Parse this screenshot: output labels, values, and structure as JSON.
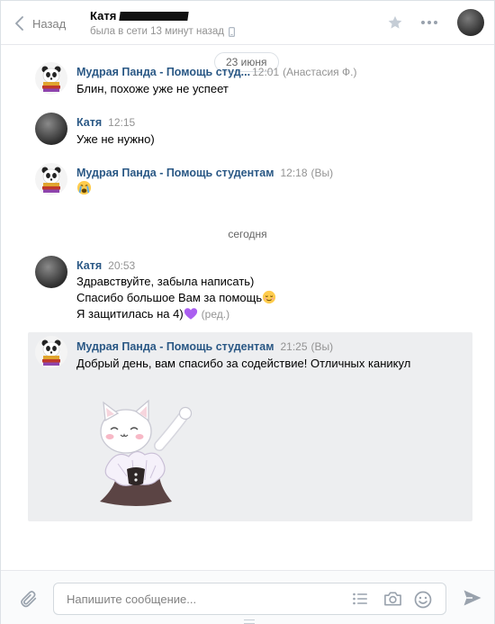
{
  "header": {
    "back_label": "Назад",
    "peer_name": "Катя",
    "peer_status": "была в сети 13 минут назад"
  },
  "dates": {
    "first": "23 июня",
    "today": "сегодня"
  },
  "messages": [
    {
      "author": "Мудрая Панда - Помощь студ...",
      "time": "12:01",
      "sender": "(Анастасия Ф.)",
      "text": "Блин, похоже уже не успеет"
    },
    {
      "author": "Катя",
      "time": "12:15",
      "text": "Уже не нужно)"
    },
    {
      "author": "Мудрая Панда - Помощь студентам",
      "time": "12:18",
      "sender": "(Вы)",
      "text": ""
    },
    {
      "author": "Катя",
      "time": "20:53",
      "lines": [
        "Здравствуйте, забыла написать)",
        "Спасибо большое Вам за помощь",
        "Я защитилась на 4)"
      ],
      "edited": "(ред.)"
    },
    {
      "author": "Мудрая Панда - Помощь студентам",
      "time": "21:25",
      "sender": "(Вы)",
      "text": "Добрый день, вам спасибо за содействие! Отличных каникул"
    }
  ],
  "composer": {
    "placeholder": "Напишите сообщение..."
  },
  "colors": {
    "link": "#2a5885",
    "muted": "#939393",
    "selected_bg": "#edeef0",
    "accent": "#4a76a8"
  },
  "icons": [
    "chevron-left-icon",
    "mobile-icon",
    "star-icon",
    "more-icon",
    "paperclip-icon",
    "list-icon",
    "camera-icon",
    "smile-icon",
    "send-icon"
  ]
}
